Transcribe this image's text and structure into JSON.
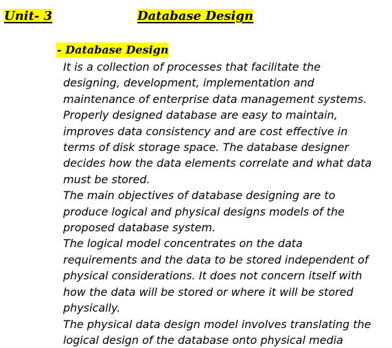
{
  "header": {
    "unit": "Unit- 3",
    "title": "Database Design"
  },
  "section": {
    "heading": "- Database Design",
    "lines": [
      "It is a collection of processes that facilitate the",
      "designing, development, implementation and",
      "maintenance of enterprise data management systems.",
      "Properly designed database are easy to maintain,",
      "improves data consistency and are cost effective in",
      "terms of disk storage space. The database designer",
      "decides how the data elements correlate and what data",
      "must be stored.",
      "The main objectives of database designing are to",
      "produce logical and physical designs models of the",
      "proposed database system.",
      "The logical model concentrates on the data",
      "requirements and the data to be stored independent of",
      "physical considerations. It does not concern itself with",
      "how the data will be stored or where it will be stored",
      "physically.",
      "The physical data design model involves translating the",
      "logical design of the database onto physical media"
    ]
  },
  "colors": {
    "highlight": "#ffff00",
    "text": "#000000",
    "background": "#ffffff"
  }
}
